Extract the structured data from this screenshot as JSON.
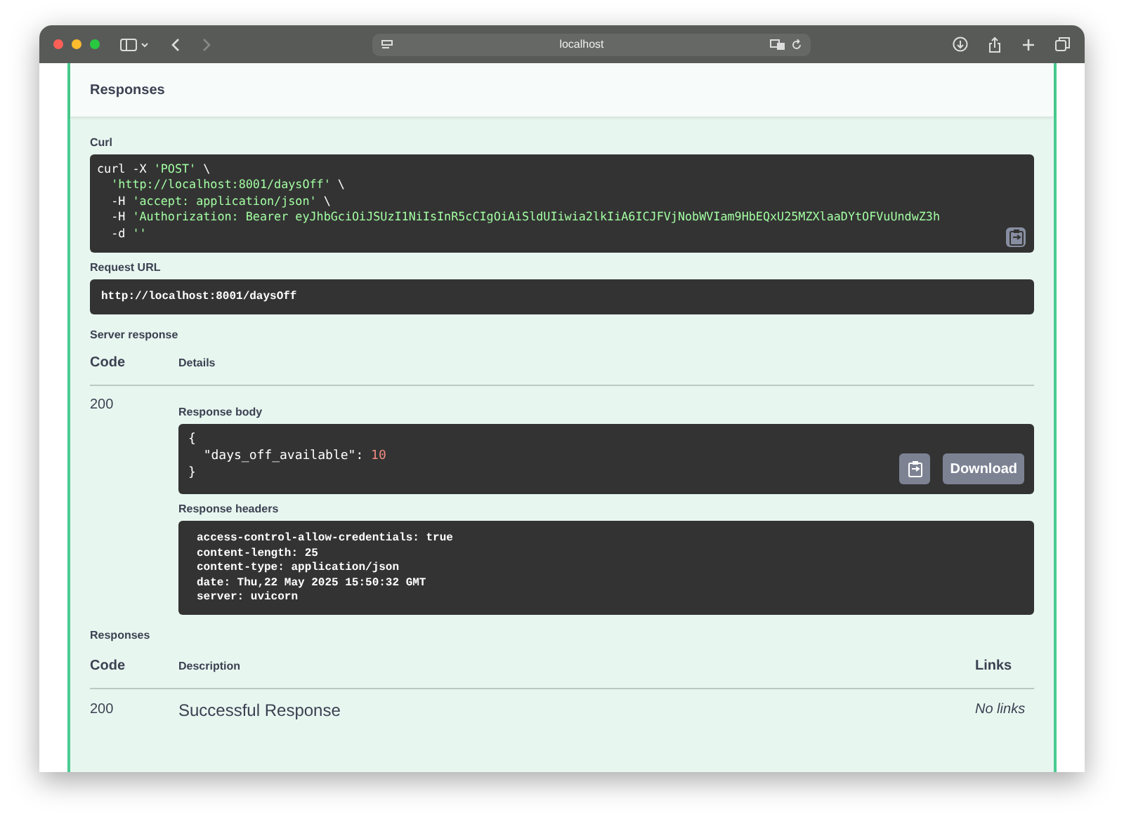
{
  "browser": {
    "address": "localhost"
  },
  "section_title": "Responses",
  "curl": {
    "label": "Curl",
    "lines": [
      [
        {
          "t": "curl -X",
          "kind": "plain"
        },
        {
          "t": "'POST'",
          "kind": "string"
        },
        {
          "t": "\\",
          "kind": "plain"
        }
      ],
      [
        {
          "t": "'http://localhost:8001/daysOff'",
          "kind": "string"
        },
        {
          "t": "\\",
          "kind": "plain"
        }
      ],
      [
        {
          "t": "-H",
          "kind": "plain"
        },
        {
          "t": "'accept: application/json'",
          "kind": "string"
        },
        {
          "t": "\\",
          "kind": "plain"
        }
      ],
      [
        {
          "t": "-H",
          "kind": "plain"
        },
        {
          "t": "'Authorization: Bearer eyJhbGciOiJSUzI1NiIsInR5cCIgOiAiSldUIiwia2lkIiA6ICJFVjNobWVIam9HbEQxU25MZXlaaDYtOFVuUndwZ3h",
          "kind": "string"
        }
      ],
      [
        {
          "t": "-d",
          "kind": "plain"
        },
        {
          "t": "''",
          "kind": "string"
        }
      ]
    ]
  },
  "request_url": {
    "label": "Request URL",
    "value": "http://localhost:8001/daysOff"
  },
  "server_response": {
    "label": "Server response",
    "code_header": "Code",
    "details_header": "Details",
    "code": "200",
    "body_label": "Response body",
    "body": [
      [
        {
          "t": "{",
          "kind": "plain"
        }
      ],
      [
        {
          "t": "\"days_off_available\":",
          "kind": "plain"
        },
        {
          "t": "10",
          "kind": "number"
        }
      ],
      [
        {
          "t": "}",
          "kind": "plain"
        }
      ]
    ],
    "download": "Download",
    "headers_label": "Response headers",
    "headers": [
      "access-control-allow-credentials: true",
      "content-length: 25",
      "content-type: application/json",
      "date: Thu,22 May 2025 15:50:32 GMT",
      "server: uvicorn"
    ]
  },
  "responses": {
    "label": "Responses",
    "columns": [
      "Code",
      "Description",
      "Links"
    ],
    "rows": [
      {
        "code": "200",
        "description": "Successful Response",
        "links": "No links"
      }
    ]
  }
}
